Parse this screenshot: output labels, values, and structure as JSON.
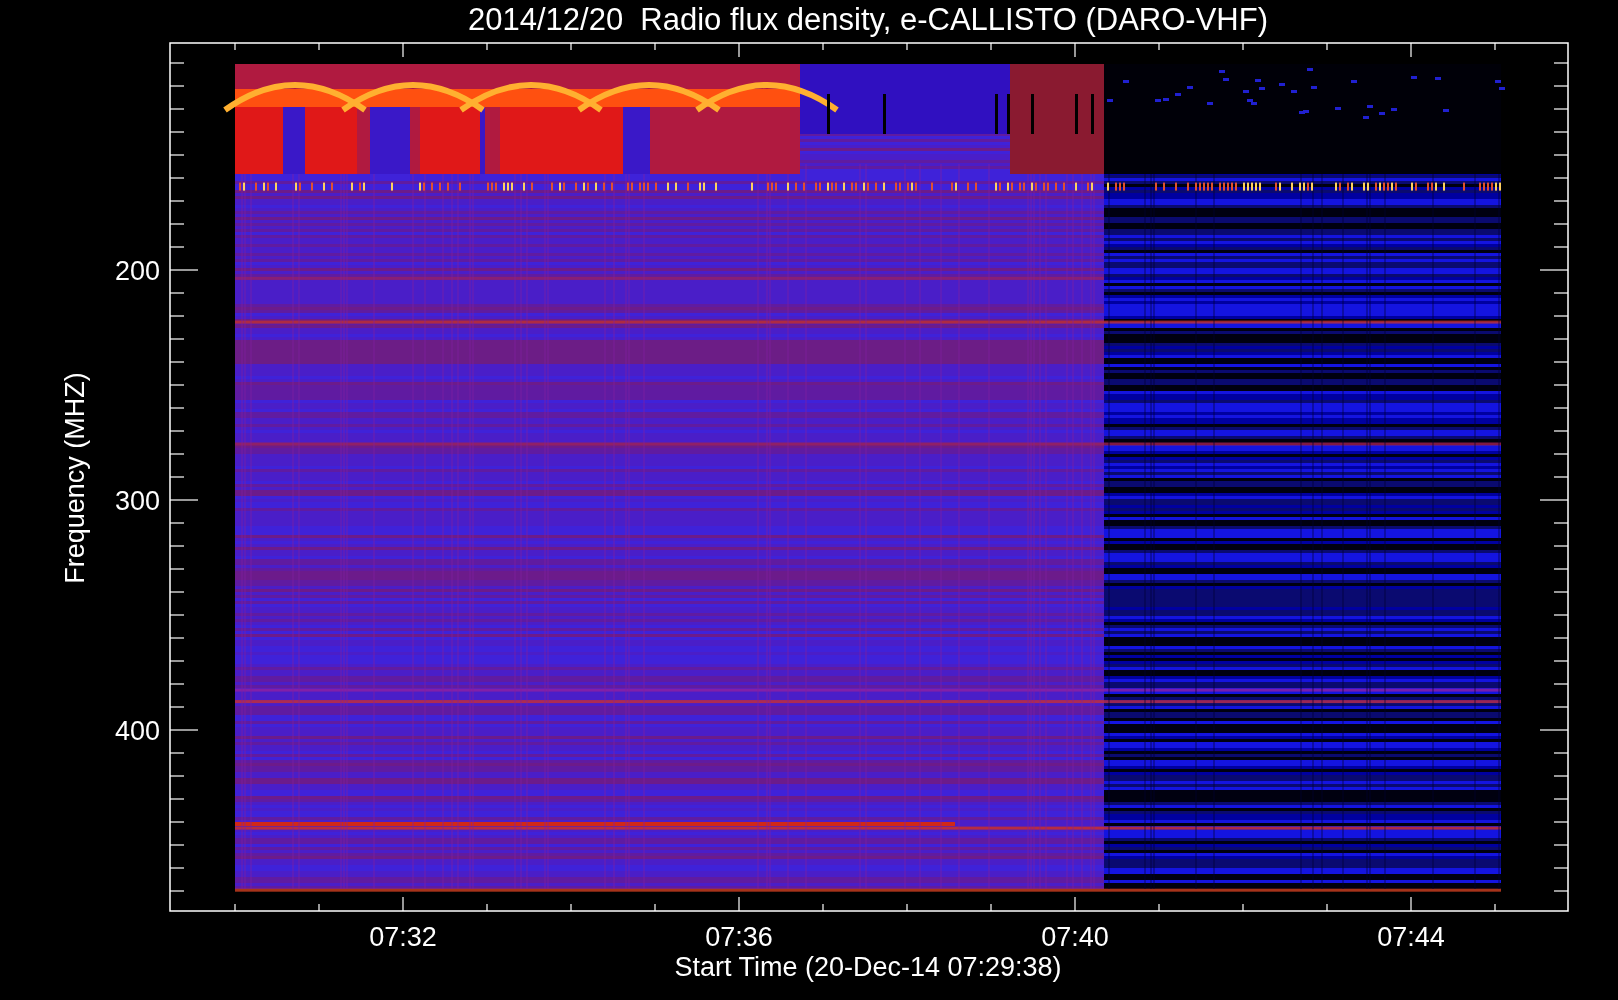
{
  "chart": {
    "title": "2014/12/20  Radio flux density, e-CALLISTO (DARO-VHF)",
    "xlabel": "Start Time (20-Dec-14 07:29:38)",
    "ylabel": "Frequency (MHZ)",
    "x_tick_labels": [
      "07:32",
      "07:36",
      "07:40",
      "07:44"
    ],
    "y_tick_labels": [
      "200",
      "300",
      "400"
    ]
  }
}
